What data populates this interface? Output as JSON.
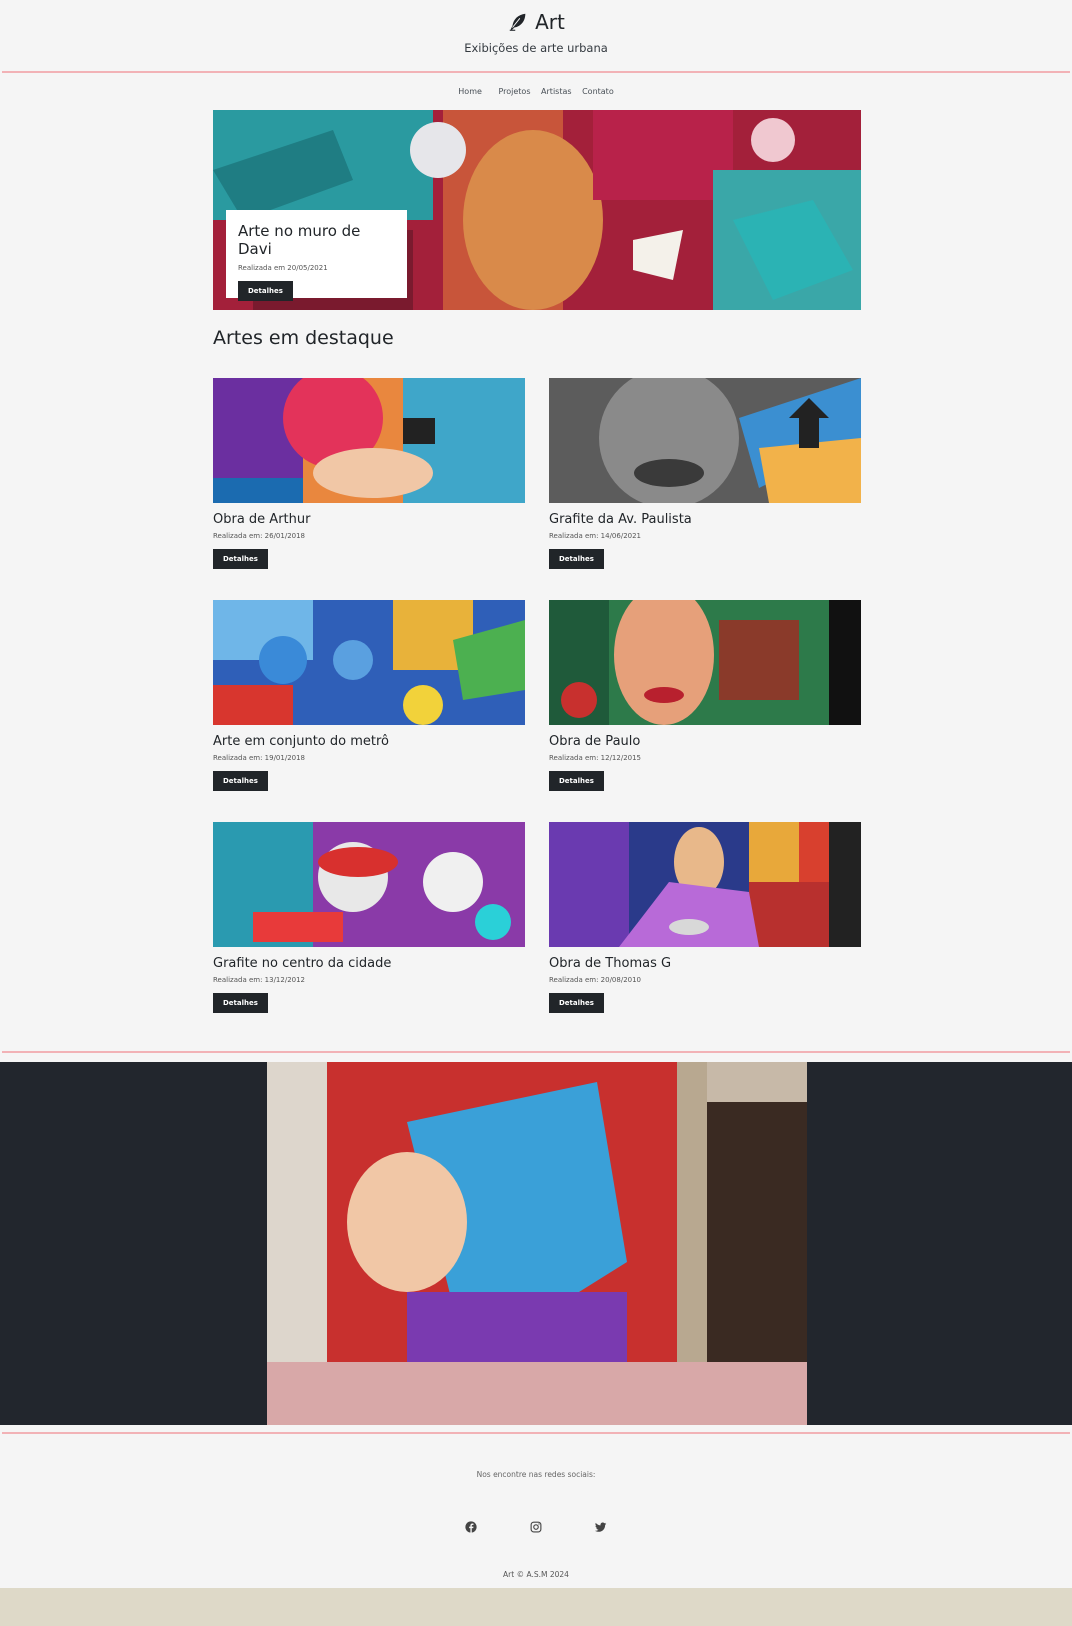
{
  "header": {
    "brand": "Art",
    "tagline": "Exibições de arte urbana",
    "logo_icon": "feather-icon"
  },
  "nav": {
    "items": [
      "Home",
      "Projetos",
      "Artistas",
      "Contato"
    ]
  },
  "hero": {
    "title": "Arte no muro de Davi",
    "date": "Realizada em 20/05/2021",
    "button": "Detalhes"
  },
  "featured": {
    "heading": "Artes em destaque",
    "cards": [
      {
        "title": "Obra de Arthur",
        "date": "Realizada em: 26/01/2018",
        "button": "Detalhes"
      },
      {
        "title": "Grafite da Av. Paulista",
        "date": "Realizada em: 14/06/2021",
        "button": "Detalhes"
      },
      {
        "title": "Arte em conjunto do metrô",
        "date": "Realizada em: 19/01/2018",
        "button": "Detalhes"
      },
      {
        "title": "Obra de Paulo",
        "date": "Realizada em: 12/12/2015",
        "button": "Detalhes"
      },
      {
        "title": "Grafite no centro da cidade",
        "date": "Realizada em: 13/12/2012",
        "button": "Detalhes"
      },
      {
        "title": "Obra de Thomas G",
        "date": "Realizada em: 20/08/2010",
        "button": "Detalhes"
      }
    ]
  },
  "footer": {
    "note": "Nos encontre nas redes sociais:",
    "socials": [
      "facebook-icon",
      "instagram-icon",
      "twitter-icon"
    ],
    "copyright": "Art © A.S.M 2024"
  },
  "colors": {
    "accent_rule": "#f2b2b6",
    "dark": "#212529",
    "banner_bg": "#22262d",
    "page_bg": "#f5f5f5"
  }
}
